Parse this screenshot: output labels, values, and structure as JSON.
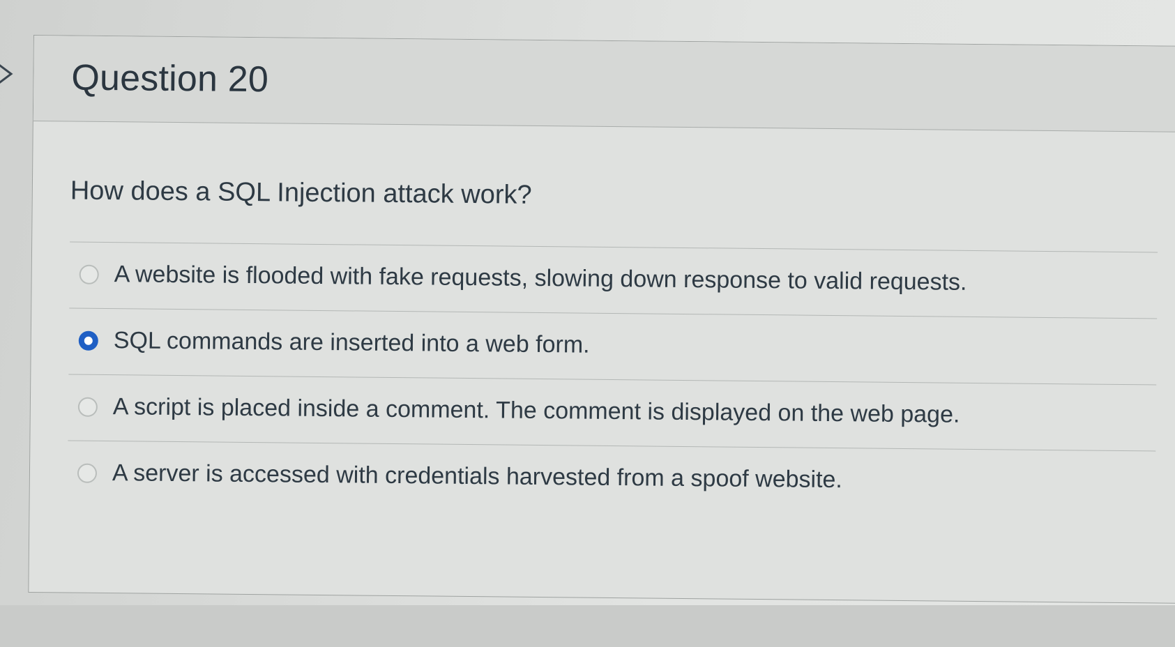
{
  "question": {
    "title": "Question 20",
    "text": "How does a SQL Injection attack work?",
    "answers": [
      {
        "label": "A website is flooded with fake requests, slowing down response to valid requests.",
        "selected": false
      },
      {
        "label": "SQL commands are inserted into a web form.",
        "selected": true
      },
      {
        "label": "A script is placed inside a comment. The comment is displayed on the web page.",
        "selected": false
      },
      {
        "label": "A server is accessed with credentials harvested from a spoof website.",
        "selected": false
      }
    ]
  },
  "colors": {
    "radio_selected": "#1f5fc4",
    "text": "#2e3a44",
    "header_bg": "#d6d8d6"
  }
}
